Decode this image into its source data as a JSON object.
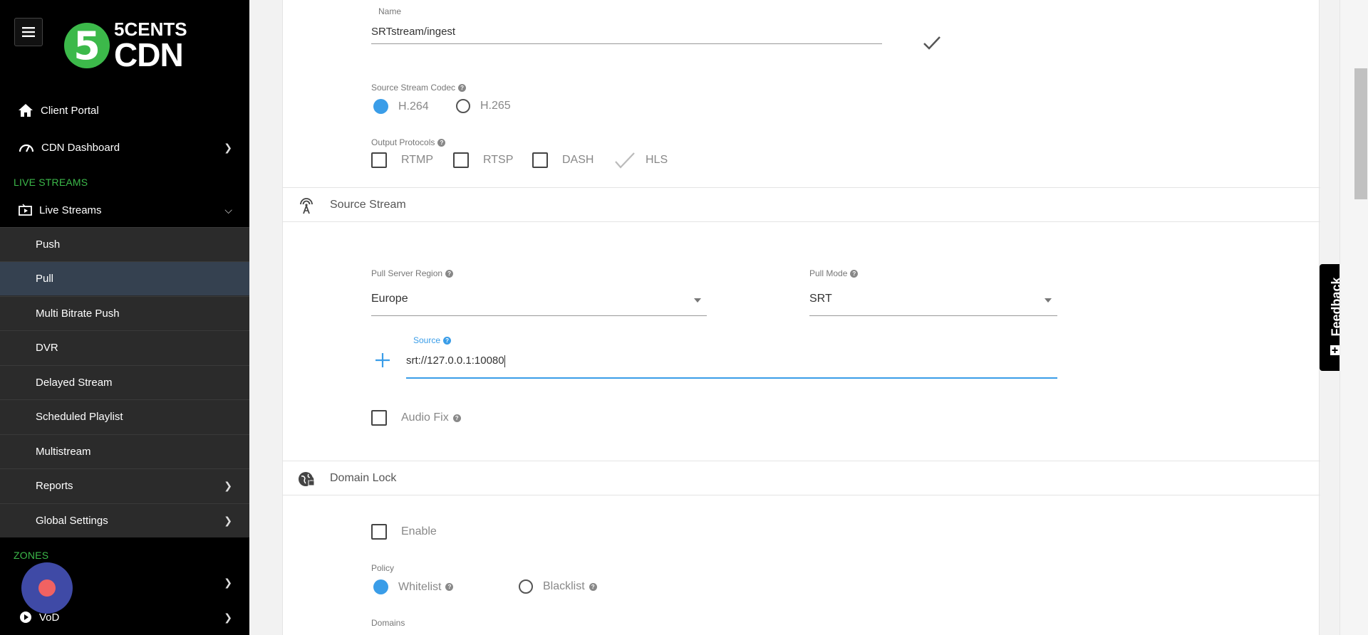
{
  "sidebar": {
    "logo": {
      "digit": "5",
      "line1": "5CENTS",
      "line2": "CDN"
    },
    "client_portal": "Client Portal",
    "cdn_dashboard": "CDN Dashboard",
    "section_live": "LIVE STREAMS",
    "live_streams": "Live Streams",
    "subitems": [
      "Push",
      "Pull",
      "Multi Bitrate Push",
      "DVR",
      "Delayed Stream",
      "Scheduled Playlist",
      "Multistream",
      "Reports",
      "Global Settings"
    ],
    "section_zones": "ZONES",
    "zones_item": "",
    "vod": "VoD"
  },
  "form": {
    "name_label": "Name",
    "name_value": "SRTstream/ingest",
    "codec_label": "Source Stream Codec",
    "codec_options": [
      "H.264",
      "H.265"
    ],
    "codec_selected": "H.264",
    "output_label": "Output Protocols",
    "output_options": [
      "RTMP",
      "RTSP",
      "DASH",
      "HLS"
    ],
    "source_stream_header": "Source Stream",
    "pull_region_label": "Pull Server Region",
    "pull_region_value": "Europe",
    "pull_mode_label": "Pull Mode",
    "pull_mode_value": "SRT",
    "source_label": "Source",
    "source_value": "srt://127.0.0.1:10080",
    "audio_fix_label": "Audio Fix",
    "domain_lock_header": "Domain Lock",
    "enable_label": "Enable",
    "policy_label": "Policy",
    "policy_options": [
      "Whitelist",
      "Blacklist"
    ],
    "domains_label": "Domains"
  },
  "feedback": {
    "label": "Feedback"
  },
  "colors": {
    "accent_green": "#3cb94a",
    "accent_blue": "#3a9de8",
    "sidebar_bg": "#000000",
    "submenu_bg": "#2b2b2b",
    "active_item_bg": "#354150"
  }
}
